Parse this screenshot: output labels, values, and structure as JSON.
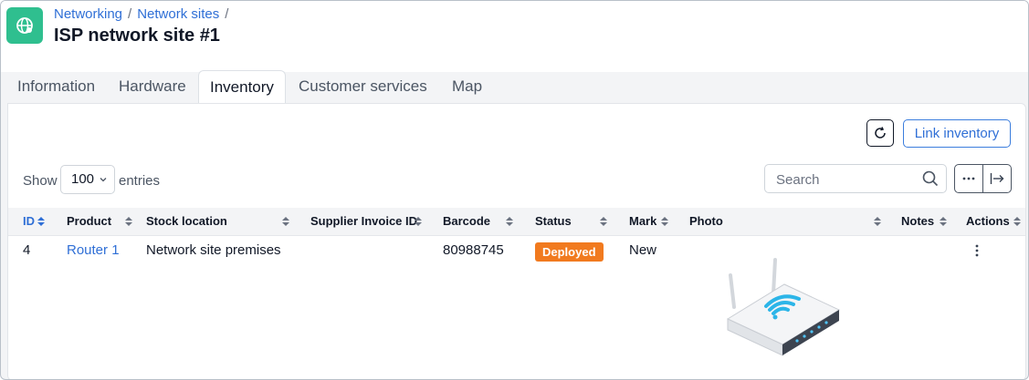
{
  "breadcrumb": [
    "Networking",
    "Network sites"
  ],
  "page_title": "ISP network site #1",
  "tabs": [
    "Information",
    "Hardware",
    "Inventory",
    "Customer services",
    "Map"
  ],
  "active_tab": "Inventory",
  "toolbar": {
    "link_inventory": "Link inventory"
  },
  "length_menu": {
    "show": "Show",
    "value": "100",
    "entries": "entries"
  },
  "search": {
    "placeholder": "Search"
  },
  "table": {
    "columns": [
      "ID",
      "Product",
      "Stock location",
      "Supplier Invoice ID",
      "Barcode",
      "Status",
      "Mark",
      "Photo",
      "Notes",
      "Actions"
    ],
    "rows": [
      {
        "id": "4",
        "product": "Router 1",
        "stock_location": "Network site premises",
        "supplier_invoice_id": "",
        "barcode": "80988745",
        "status": "Deployed",
        "mark": "New",
        "photo": "router-image",
        "notes": ""
      }
    ]
  },
  "colors": {
    "accent": "#2f6fd6",
    "logo": "#2fbf8f",
    "status_deployed": "#f17a1f"
  }
}
